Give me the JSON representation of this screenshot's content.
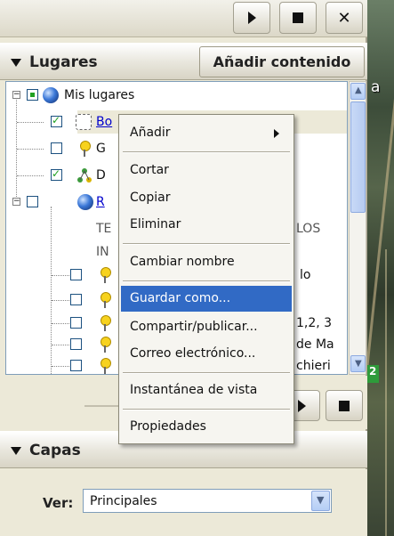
{
  "map": {
    "label": "a",
    "tag": "2"
  },
  "toolbar": {
    "play_icon": "play-icon",
    "stop_icon": "stop-icon",
    "close_glyph": "✕"
  },
  "places": {
    "title": "Lugares",
    "add_content": "Añadir contenido",
    "tree": [
      {
        "label": "Mis lugares",
        "icon": "globe-icon",
        "link": false
      },
      {
        "label": "Bo",
        "icon": "route-icon",
        "link": true,
        "selected": true
      },
      {
        "label": "G",
        "icon": "pushpin-icon",
        "link": false
      },
      {
        "label": "D",
        "icon": "network-icon",
        "link": false
      },
      {
        "label": "R",
        "icon": "globe-icon",
        "link": true
      },
      {
        "label": "TE",
        "label_right": "LOS",
        "icon": "",
        "link": false
      },
      {
        "label": "IN",
        "icon": "",
        "link": false
      },
      {
        "label": "",
        "label_right": "lo",
        "icon": "pushpin-icon",
        "link": false
      },
      {
        "label": "",
        "icon": "pushpin-icon",
        "link": false
      },
      {
        "label": "",
        "label_right": "1,2, 3",
        "icon": "pushpin-icon",
        "link": false
      },
      {
        "label": "",
        "label_right": "de Ma",
        "icon": "pushpin-icon",
        "link": false
      },
      {
        "label": "",
        "label_right": "chieri",
        "icon": "pushpin-icon",
        "link": false
      }
    ]
  },
  "context_menu": {
    "items": [
      {
        "label": "Añadir",
        "submenu": true
      },
      {
        "label": "Cortar"
      },
      {
        "label": "Copiar"
      },
      {
        "label": "Eliminar"
      },
      {
        "label": "Cambiar nombre"
      },
      {
        "label": "Guardar como...",
        "highlighted": true
      },
      {
        "label": "Compartir/publicar..."
      },
      {
        "label": "Correo electrónico..."
      },
      {
        "label": "Instantánea de vista"
      },
      {
        "label": "Propiedades"
      }
    ]
  },
  "layers": {
    "title": "Capas",
    "view_label": "Ver:",
    "view_value": "Principales"
  },
  "colors": {
    "highlight": "#316ac5",
    "link": "#0000cc"
  }
}
